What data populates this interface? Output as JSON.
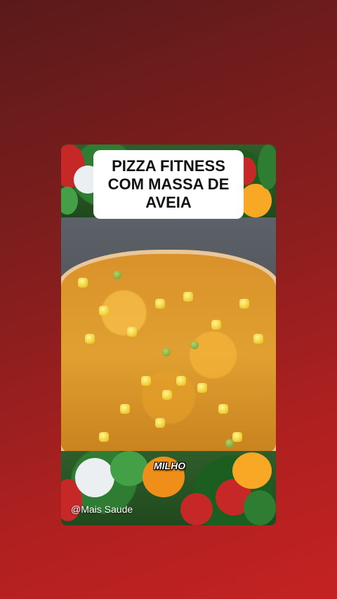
{
  "video": {
    "title": "PIZZA FITNESS COM MASSA DE AVEIA",
    "caption": "MILHO",
    "handle": "@Mais Saude"
  },
  "colors": {
    "background_top": "#5a1a1a",
    "background_bottom": "#c42222",
    "title_box": "#ffffff",
    "title_text": "#111111"
  }
}
